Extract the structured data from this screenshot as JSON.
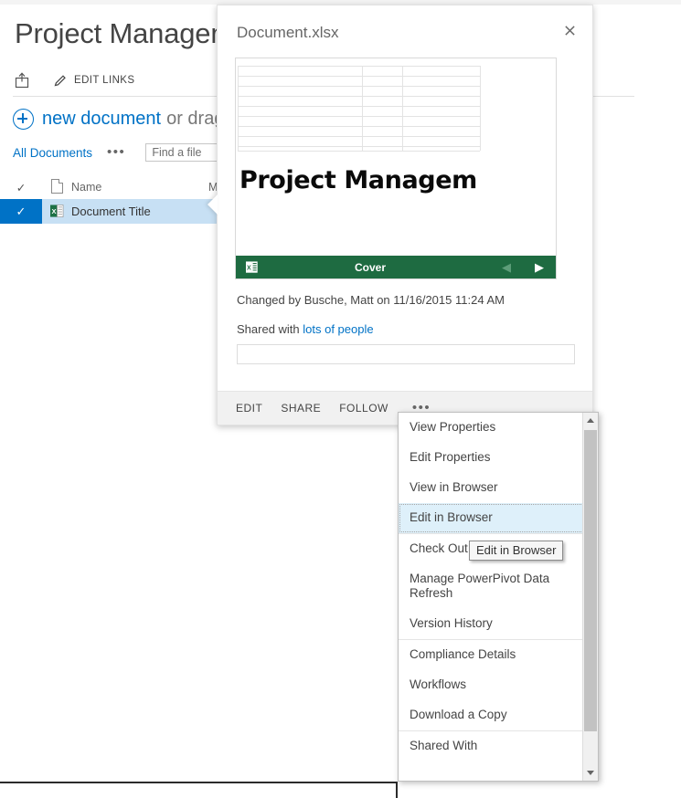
{
  "page": {
    "title": "Project Management",
    "share_icon": "share-icon",
    "edit_links_label": "EDIT LINKS",
    "edit_links_icon": "pencil-icon",
    "new_document_link": "new document",
    "new_document_rest": "or drag",
    "plus_icon": "plus-circle-icon"
  },
  "toolbar": {
    "view_label": "All Documents",
    "ellipsis": "•••",
    "find_placeholder": "Find a file",
    "find_value": ""
  },
  "list": {
    "header": {
      "check_icon": "checkmark-icon",
      "doc_icon": "document-icon",
      "name": "Name",
      "modified_partial": "M"
    },
    "rows": [
      {
        "selected_check": "✓",
        "file_icon": "excel-file-icon",
        "name": "Document Title",
        "ellipsis": "•••"
      }
    ]
  },
  "callout": {
    "title": "Document.xlsx",
    "close_icon": "close-icon",
    "preview": {
      "heading": "Project Managem",
      "app_icon": "excel-icon",
      "sheet_label": "Cover",
      "prev_icon": "triangle-left-icon",
      "next_icon": "triangle-right-icon"
    },
    "changed_by": "Changed by Busche, Matt on 11/16/2015 11:24 AM",
    "shared_with_prefix": "Shared with ",
    "shared_with_link": "lots of people",
    "note_value": "",
    "note_placeholder": "",
    "actions": [
      {
        "label": "EDIT"
      },
      {
        "label": "SHARE"
      },
      {
        "label": "FOLLOW"
      }
    ],
    "actions_ellipsis": "•••"
  },
  "context_menu": {
    "groups": [
      {
        "items": [
          {
            "label": "View Properties",
            "highlighted": false
          },
          {
            "label": "Edit Properties",
            "highlighted": false
          },
          {
            "label": "View in Browser",
            "highlighted": false
          },
          {
            "label": "Edit in Browser",
            "highlighted": true
          }
        ]
      },
      {
        "items": [
          {
            "label": "Check Out",
            "highlighted": false
          },
          {
            "label": "Manage PowerPivot Data Refresh",
            "highlighted": false
          },
          {
            "label": "Version History",
            "highlighted": false
          }
        ]
      },
      {
        "items": [
          {
            "label": "Compliance Details",
            "highlighted": false
          },
          {
            "label": "Workflows",
            "highlighted": false
          },
          {
            "label": "Download a Copy",
            "highlighted": false
          }
        ]
      },
      {
        "items": [
          {
            "label": "Shared With",
            "highlighted": false
          }
        ]
      }
    ],
    "scrollbar": {
      "up_icon": "scroll-up-arrow-icon",
      "down_icon": "scroll-down-arrow-icon"
    }
  },
  "tooltip": {
    "text": "Edit in Browser"
  },
  "colors": {
    "accent_blue": "#0072c6",
    "selection_blue": "#c7e0f4",
    "highlight_blue": "#def0fa",
    "excel_green": "#1e6b41",
    "action_bar_gray": "#f1f1f1"
  }
}
